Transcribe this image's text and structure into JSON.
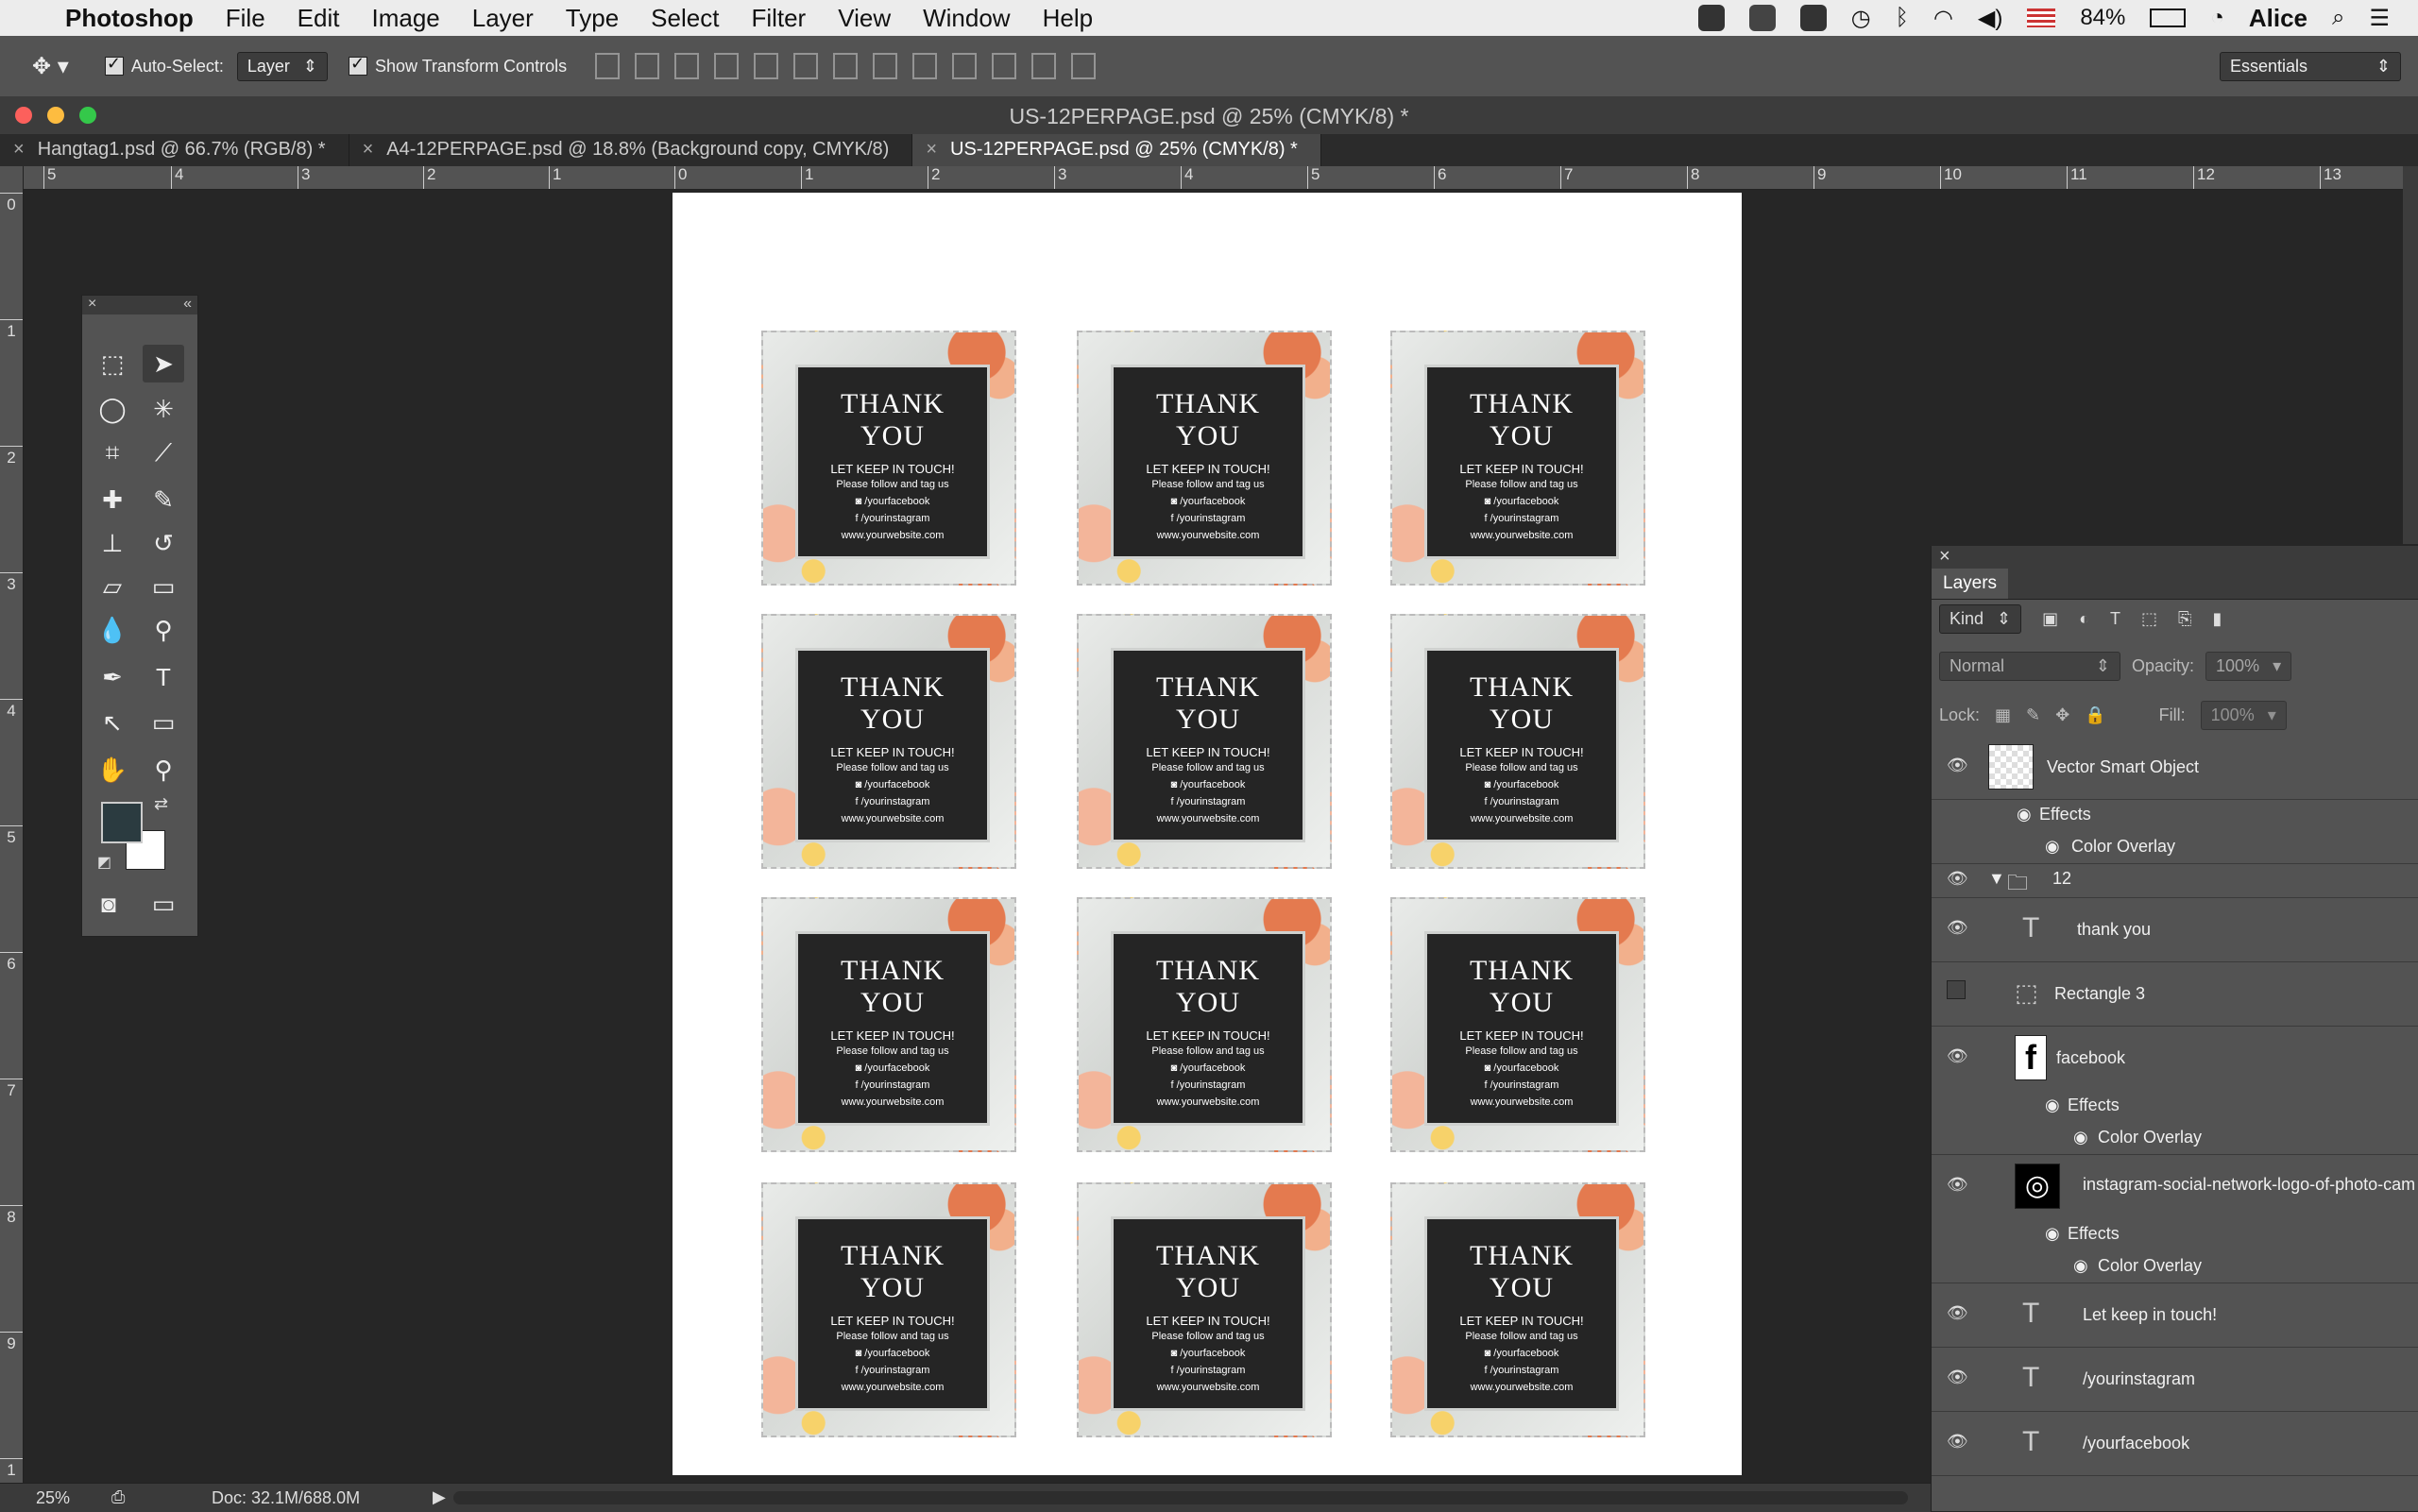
{
  "menubar": {
    "app": "Photoshop",
    "items": [
      "File",
      "Edit",
      "Image",
      "Layer",
      "Type",
      "Select",
      "Filter",
      "View",
      "Window",
      "Help"
    ],
    "battery": "84%",
    "user": "Alice"
  },
  "options": {
    "auto_select_label": "Auto-Select:",
    "auto_select_value": "Layer",
    "transform_label": "Show Transform Controls",
    "workspace": "Essentials"
  },
  "window": {
    "title": "US-12PERPAGE.psd @ 25% (CMYK/8) *",
    "tabs": [
      {
        "label": "Hangtag1.psd @ 66.7% (RGB/8) *"
      },
      {
        "label": "A4-12PERPAGE.psd @ 18.8% (Background copy, CMYK/8)"
      },
      {
        "label": "US-12PERPAGE.psd @ 25% (CMYK/8) *"
      }
    ]
  },
  "ruler": {
    "h": [
      "5",
      "4",
      "3",
      "2",
      "1",
      "0",
      "1",
      "2",
      "3",
      "4",
      "5",
      "6",
      "7",
      "8",
      "9",
      "10",
      "11",
      "12",
      "13"
    ],
    "v": [
      "0",
      "1",
      "2",
      "3",
      "4",
      "5",
      "6",
      "7",
      "8",
      "9",
      "1"
    ]
  },
  "card": {
    "title1": "THANK",
    "title2": "YOU",
    "keep": "LET KEEP IN TOUCH!",
    "follow": "Please follow and tag us",
    "facebook": "/yourfacebook",
    "instagram": "/yourinstagram",
    "website": "www.yourwebsite.com"
  },
  "layers_panel": {
    "title": "Layers",
    "kind": "Kind",
    "blend": "Normal",
    "opacity_label": "Opacity:",
    "opacity_value": "100%",
    "lock_label": "Lock:",
    "fill_label": "Fill:",
    "fill_value": "100%",
    "rows": {
      "r0": "Vector Smart Object",
      "r1": "Effects",
      "r2": "Color Overlay",
      "r3": "12",
      "r4": "thank you",
      "r5": "Rectangle 3",
      "r6": "facebook",
      "r7": "Effects",
      "r8": "Color Overlay",
      "r9": "instagram-social-network-logo-of-photo-cam",
      "r10": "Effects",
      "r11": "Color Overlay",
      "r12": "Let keep in touch!",
      "r13": "/yourinstagram",
      "r14": "/yourfacebook"
    }
  },
  "status": {
    "zoom": "25%",
    "doc": "Doc: 32.1M/688.0M"
  },
  "colors": {
    "foreground": "#2b3b40",
    "background": "#ffffff",
    "accent": "#e47a4f"
  }
}
